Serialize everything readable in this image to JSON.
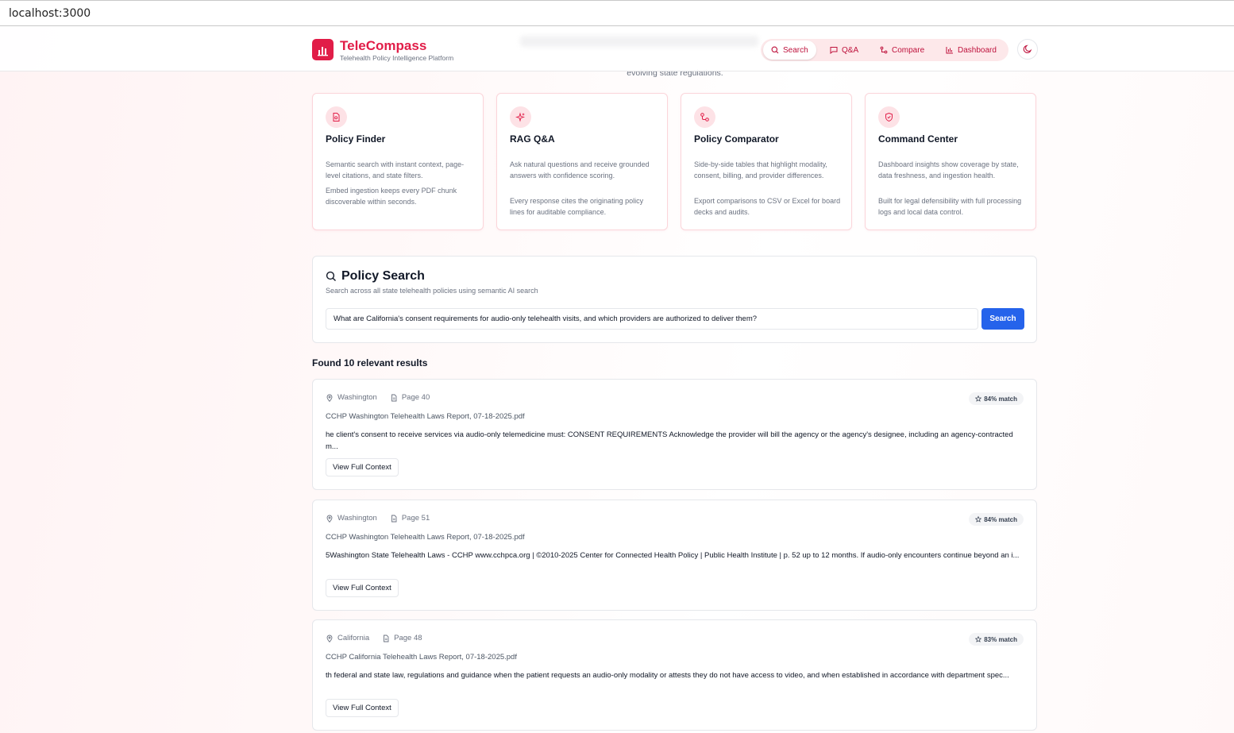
{
  "browser": {
    "url": "localhost:3000"
  },
  "header": {
    "brand": "TeleCompass",
    "subtitle": "Telehealth Policy Intelligence Platform",
    "nav": [
      {
        "label": "Search",
        "icon": "search-icon",
        "active": true
      },
      {
        "label": "Q&A",
        "icon": "message-square-icon",
        "active": false
      },
      {
        "label": "Compare",
        "icon": "compare-arrows-icon",
        "active": false
      },
      {
        "label": "Dashboard",
        "icon": "bar-chart-icon",
        "active": false
      }
    ],
    "theme_toggle_icon": "moon-icon"
  },
  "hero": {
    "tagline_tail": "evolving state regulations."
  },
  "features": [
    {
      "title": "Policy Finder",
      "icon": "document-search-icon",
      "text1": "Semantic search with instant context, page-level citations, and state filters.",
      "text2": "Embed ingestion keeps every PDF chunk discoverable within seconds."
    },
    {
      "title": "RAG Q&A",
      "icon": "sparkles-icon",
      "text1": "Ask natural questions and receive grounded answers with confidence scoring.",
      "text2": "Every response cites the originating policy lines for auditable compliance."
    },
    {
      "title": "Policy Comparator",
      "icon": "git-compare-icon",
      "text1": "Side-by-side tables that highlight modality, consent, billing, and provider differences.",
      "text2": "Export comparisons to CSV or Excel for board decks and audits."
    },
    {
      "title": "Command Center",
      "icon": "shield-check-icon",
      "text1": "Dashboard insights show coverage by state, data freshness, and ingestion health.",
      "text2": "Built for legal defensibility with full processing logs and local data control."
    }
  ],
  "search": {
    "title": "Policy Search",
    "subtitle": "Search across all state telehealth policies using semantic AI search",
    "query": "What are California's consent requirements for audio-only telehealth visits, and which providers are authorized to deliver them?",
    "button": "Search"
  },
  "results_header": "Found 10 relevant results",
  "results": [
    {
      "state": "Washington",
      "page": "Page 40",
      "match": "84% match",
      "document": "CCHP Washington Telehealth Laws Report, 07-18-2025.pdf",
      "snippet": "he client's consent to receive services via audio-only telemedicine must: CONSENT REQUIREMENTS Acknowledge the provider will bill the agency or the agency's designee, including an agency-contracted m...",
      "button": "View Full Context"
    },
    {
      "state": "Washington",
      "page": "Page 51",
      "match": "84% match",
      "document": "CCHP Washington Telehealth Laws Report, 07-18-2025.pdf",
      "snippet": "5Washington State Telehealth Laws - CCHP www.cchpca.org | ©2010-2025 Center for Connected Health Policy | Public Health Institute | p. 52 up to 12 months. If audio-only encounters continue beyond an i...",
      "button": "View Full Context"
    },
    {
      "state": "California",
      "page": "Page 48",
      "match": "83% match",
      "document": "CCHP California Telehealth Laws Report, 07-18-2025.pdf",
      "snippet": "th federal and state law, regulations and guidance when the patient requests an audio-only modality or attests they do not have access to video, and when established in accordance with department spec...",
      "button": "View Full Context"
    }
  ],
  "colors": {
    "brand": "#e11d48",
    "primary_button": "#2563eb",
    "nav_background": "#fde8ea"
  }
}
